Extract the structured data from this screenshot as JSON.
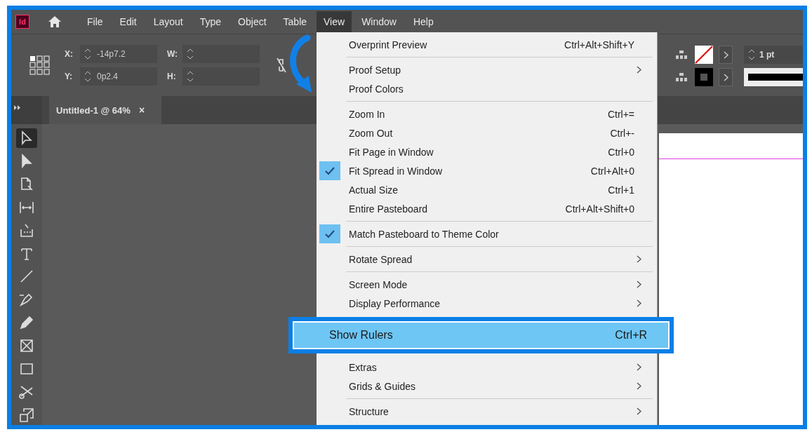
{
  "app": {
    "logo": "Id"
  },
  "menu_bar": [
    {
      "label": "File",
      "selected": false
    },
    {
      "label": "Edit",
      "selected": false
    },
    {
      "label": "Layout",
      "selected": false
    },
    {
      "label": "Type",
      "selected": false
    },
    {
      "label": "Object",
      "selected": false
    },
    {
      "label": "Table",
      "selected": false
    },
    {
      "label": "View",
      "selected": true
    },
    {
      "label": "Window",
      "selected": false
    },
    {
      "label": "Help",
      "selected": false
    }
  ],
  "control_panel": {
    "x": {
      "label": "X:",
      "value": "-14p7.2"
    },
    "y": {
      "label": "Y:",
      "value": "0p2.4"
    },
    "w": {
      "label": "W:"
    },
    "h": {
      "label": "H:"
    },
    "stroke_weight": "1 pt"
  },
  "document_tab": {
    "title": "Untitled-1 @ 64%",
    "close": "×"
  },
  "tools": [
    {
      "kind": "selection",
      "selected": true
    },
    {
      "kind": "direct",
      "selected": false
    },
    {
      "kind": "page",
      "selected": false
    },
    {
      "kind": "gap",
      "selected": false
    },
    {
      "kind": "collector",
      "selected": false
    },
    {
      "kind": "type",
      "selected": false
    },
    {
      "kind": "line",
      "selected": false
    },
    {
      "kind": "pen",
      "selected": false
    },
    {
      "kind": "pencil",
      "selected": false
    },
    {
      "kind": "frame",
      "selected": false
    },
    {
      "kind": "rect",
      "selected": false
    },
    {
      "kind": "scissors",
      "selected": false
    },
    {
      "kind": "transform",
      "selected": false
    }
  ],
  "view_menu": [
    {
      "kind": "item",
      "label": "Overprint Preview",
      "shortcut": "Ctrl+Alt+Shift+Y",
      "checked": false,
      "submenu": false,
      "highlighted": false
    },
    {
      "kind": "separator"
    },
    {
      "kind": "item",
      "label": "Proof Setup",
      "checked": false,
      "submenu": true,
      "highlighted": false
    },
    {
      "kind": "item",
      "label": "Proof Colors",
      "checked": false,
      "submenu": false,
      "highlighted": false
    },
    {
      "kind": "separator"
    },
    {
      "kind": "item",
      "label": "Zoom In",
      "shortcut": "Ctrl+=",
      "checked": false,
      "submenu": false,
      "highlighted": false
    },
    {
      "kind": "item",
      "label": "Zoom Out",
      "shortcut": "Ctrl+-",
      "checked": false,
      "submenu": false,
      "highlighted": false
    },
    {
      "kind": "item",
      "label": "Fit Page in Window",
      "shortcut": "Ctrl+0",
      "checked": false,
      "submenu": false,
      "highlighted": false
    },
    {
      "kind": "item",
      "label": "Fit Spread in Window",
      "shortcut": "Ctrl+Alt+0",
      "checked": true,
      "submenu": false,
      "highlighted": false
    },
    {
      "kind": "item",
      "label": "Actual Size",
      "shortcut": "Ctrl+1",
      "checked": false,
      "submenu": false,
      "highlighted": false
    },
    {
      "kind": "item",
      "label": "Entire Pasteboard",
      "shortcut": "Ctrl+Alt+Shift+0",
      "checked": false,
      "submenu": false,
      "highlighted": false
    },
    {
      "kind": "separator"
    },
    {
      "kind": "item",
      "label": "Match Pasteboard to Theme Color",
      "checked": true,
      "submenu": false,
      "highlighted": false
    },
    {
      "kind": "separator"
    },
    {
      "kind": "item",
      "label": "Rotate Spread",
      "checked": false,
      "submenu": true,
      "highlighted": false
    },
    {
      "kind": "separator"
    },
    {
      "kind": "item",
      "label": "Screen Mode",
      "checked": false,
      "submenu": true,
      "highlighted": false
    },
    {
      "kind": "item",
      "label": "Display Performance",
      "checked": false,
      "submenu": true,
      "highlighted": false
    },
    {
      "kind": "item",
      "label": "Show Rulers",
      "shortcut": "Ctrl+R",
      "checked": false,
      "submenu": false,
      "highlighted": true
    },
    {
      "kind": "item",
      "label": "Extras",
      "checked": false,
      "submenu": true,
      "highlighted": false
    },
    {
      "kind": "item",
      "label": "Grids & Guides",
      "checked": false,
      "submenu": true,
      "highlighted": false
    },
    {
      "kind": "separator"
    },
    {
      "kind": "item",
      "label": "Structure",
      "checked": false,
      "submenu": true,
      "highlighted": false
    }
  ]
}
